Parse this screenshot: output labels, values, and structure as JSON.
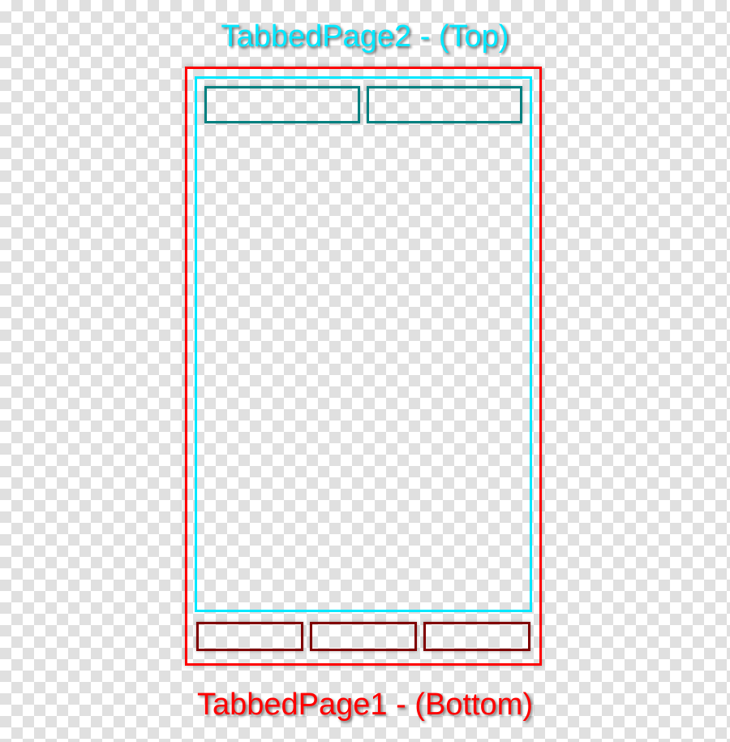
{
  "labels": {
    "top": "TabbedPage2 - (Top)",
    "bottom": "TabbedPage1 - (Bottom)"
  },
  "colors": {
    "outer": "#ff0000",
    "inner": "#00e8ff",
    "topTabBorder": "#008080",
    "bottomTabBorder": "#800000"
  },
  "structure": {
    "outerPage": "TabbedPage1",
    "outerTabPosition": "Bottom",
    "outerTabCount": 3,
    "innerPage": "TabbedPage2",
    "innerTabPosition": "Top",
    "innerTabCount": 2
  }
}
